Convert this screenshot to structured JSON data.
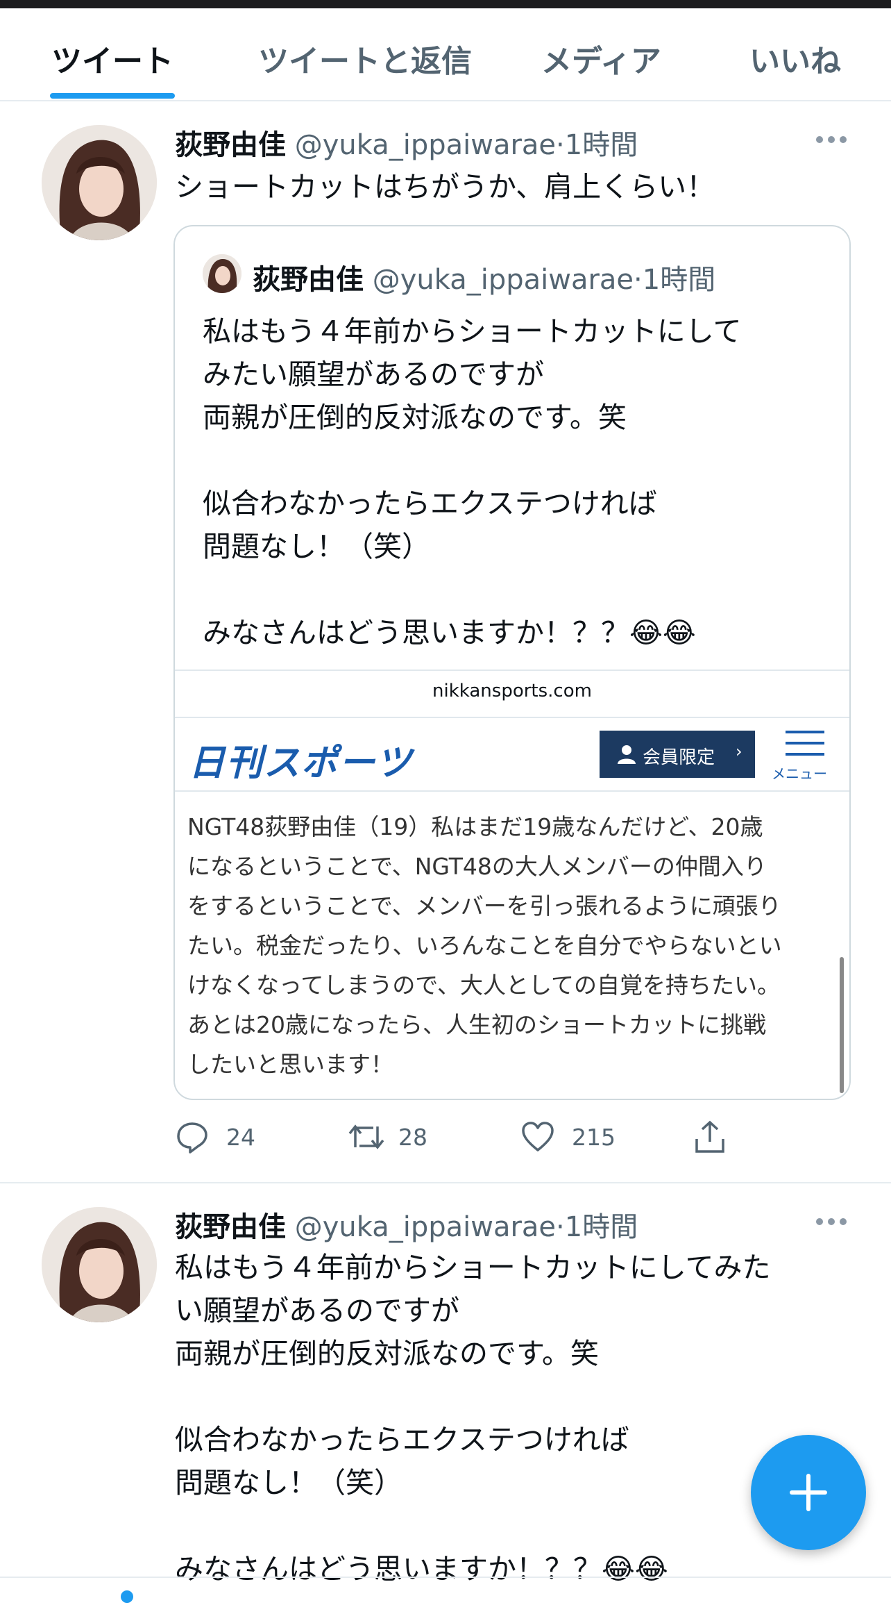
{
  "tabs": [
    "ツイート",
    "ツイートと返信",
    "メディア",
    "いいね"
  ],
  "colors": {
    "accent": "#1d9bf0",
    "text": "#0f1419",
    "muted": "#536471",
    "nikkan_blue": "#1a5cad",
    "member_navy": "#1c3a61"
  },
  "tweet1": {
    "name": "荻野由佳",
    "handle": "@yuka_ippaiwarae",
    "sep": "·",
    "time": "1時間",
    "text": "ショートカットはちがうか、肩上くらい！",
    "quote": {
      "name": "荻野由佳",
      "handle": "@yuka_ippaiwarae",
      "sep": "·",
      "time": "1時間",
      "text": "私はもう４年前からショートカットにして\nみたい願望があるのですが\n両親が圧倒的反対派なのです。笑\n\n似合わなかったらエクステつければ\n問題なし！（笑）\n\nみなさんはどう思いますか！？？😂😂",
      "card": {
        "domain": "nikkansports.com",
        "logo": "日刊スポーツ",
        "member_button": "会員限定",
        "menu_label": "メニュー",
        "article": "NGT48荻野由佳（19）私はまだ19歳なんだけど、20歳\nになるということで、NGT48の大人メンバーの仲間入り\nをするということで、メンバーを引っ張れるように頑張り\nたい。税金だったり、いろんなことを自分でやらないとい\nけなくなってしまうので、大人としての自覚を持ちたい。\nあとは20歳になったら、人生初のショートカットに挑戦\nしたいと思います！"
      }
    },
    "actions": {
      "reply": "24",
      "retweet": "28",
      "like": "215"
    },
    "icons": [
      "reply-icon",
      "retweet-icon",
      "like-icon",
      "share-icon",
      "more-icon"
    ]
  },
  "tweet2": {
    "name": "荻野由佳",
    "handle": "@yuka_ippaiwarae",
    "sep": "·",
    "time": "1時間",
    "text": "私はもう４年前からショートカットにしてみた\nい願望があるのですが\n両親が圧倒的反対派なのです。笑\n\n似合わなかったらエクステつければ\n問題なし！（笑）\n\nみなさんはどう思いますか！？？😂😂"
  },
  "fab": {
    "icon": "compose-plus-icon"
  }
}
